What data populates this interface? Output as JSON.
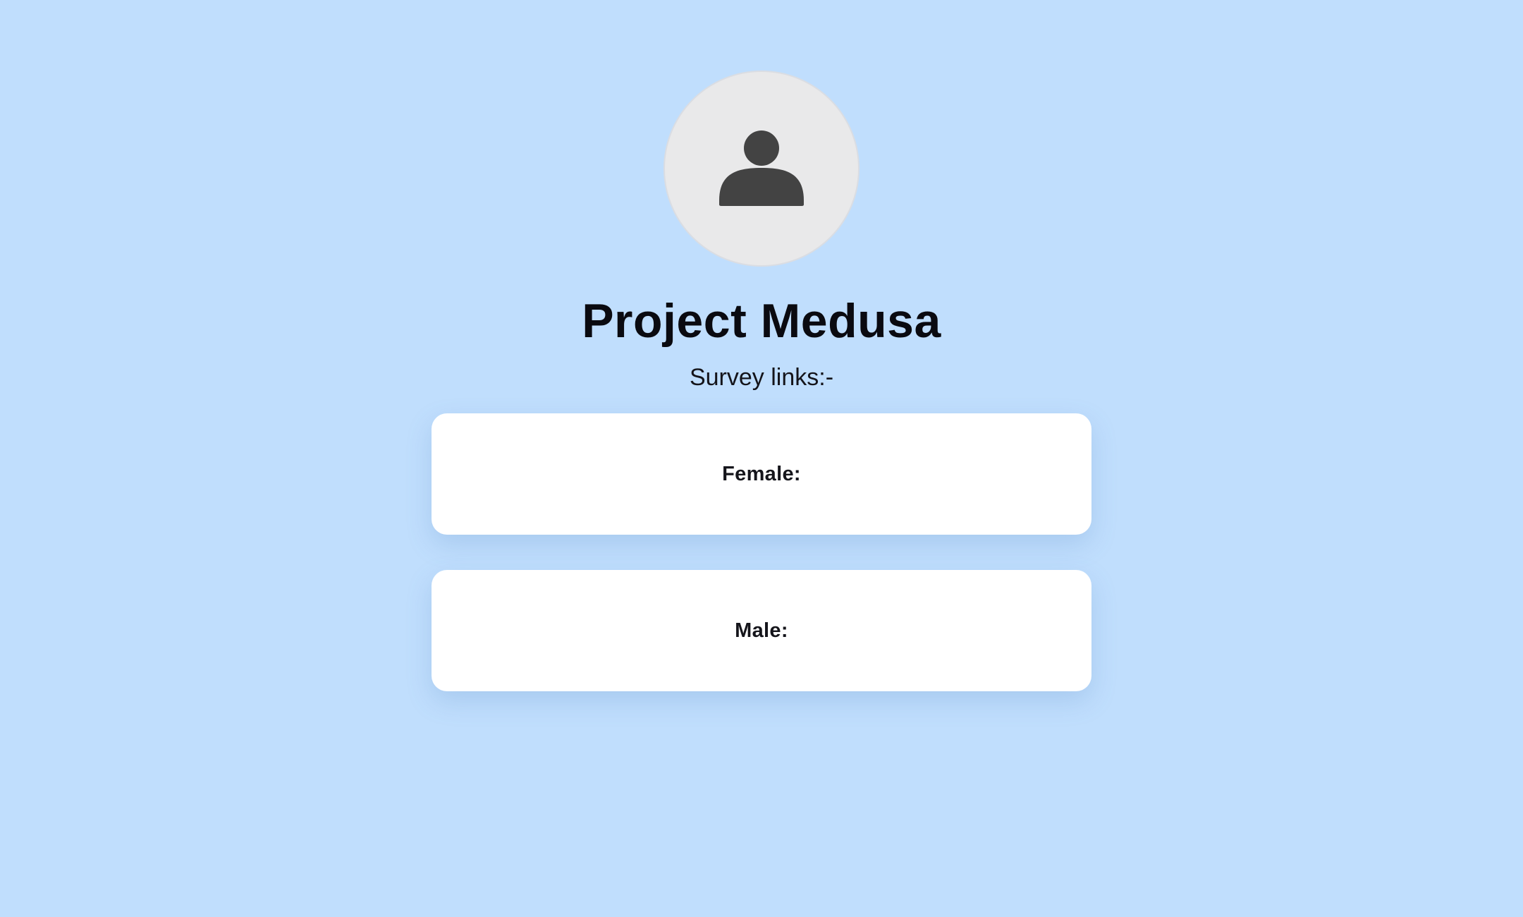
{
  "profile": {
    "avatar_icon": "user-icon",
    "title": "Project Medusa",
    "subtitle": "Survey links:-"
  },
  "links": [
    {
      "label": "Female:"
    },
    {
      "label": "Male:"
    }
  ],
  "colors": {
    "background": "#c0defd",
    "avatar_background": "#e9e9ea",
    "avatar_icon": "#434343",
    "card_background": "#ffffff",
    "text": "#0a0a10"
  }
}
